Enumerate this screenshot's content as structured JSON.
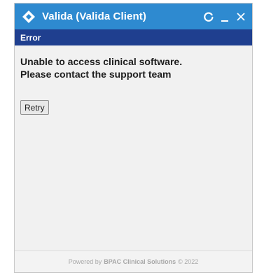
{
  "window": {
    "title": "Valida (Valida Client)",
    "logo_icon": "diamond-logo-icon",
    "controls": {
      "refresh_icon": "refresh-icon",
      "minimize_icon": "minimize-icon",
      "close_icon": "close-icon"
    }
  },
  "subheader": {
    "label": "Error"
  },
  "error": {
    "line1": "Unable to access clinical software.",
    "line2": "Please contact the support team"
  },
  "retry_button": {
    "label": "Retry"
  },
  "footer": {
    "prefix": "Powered by",
    "brand": "BPAC Clinical Solutions",
    "suffix": "© 2022"
  },
  "colors": {
    "titlebar": "#2e8ad0",
    "subheader": "#1f3f8f",
    "body": "#f1f1f1"
  }
}
